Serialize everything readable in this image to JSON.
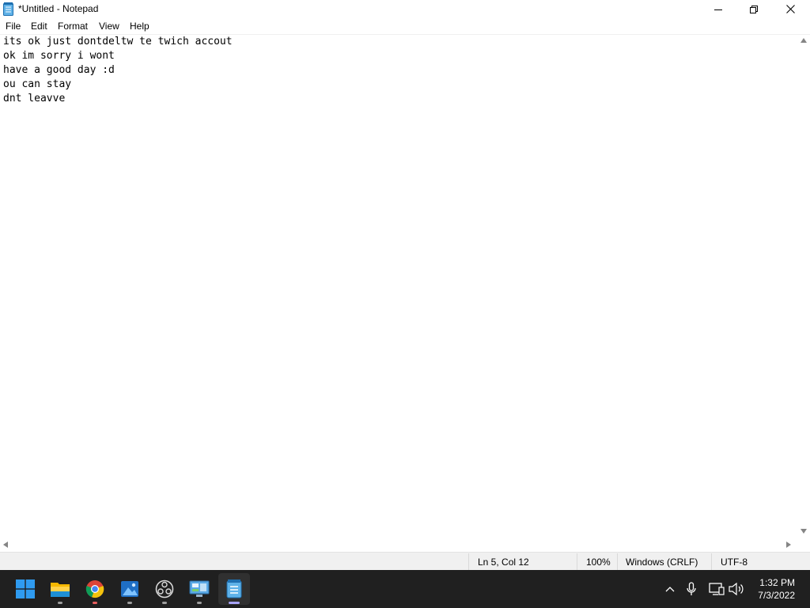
{
  "window": {
    "title": "*Untitled - Notepad",
    "buttons": {
      "minimize": "minimize",
      "maximize": "restore",
      "close": "close"
    }
  },
  "menu": {
    "items": [
      {
        "label": "File"
      },
      {
        "label": "Edit"
      },
      {
        "label": "Format"
      },
      {
        "label": "View"
      },
      {
        "label": "Help"
      }
    ]
  },
  "editor": {
    "lines": [
      "its ok just dontdeltw te twich accout",
      "ok im sorry i wont",
      "have a good day :d",
      "ou can stay",
      "dnt leavve"
    ]
  },
  "status": {
    "position": "Ln 5, Col 12",
    "zoom": "100%",
    "line_ending": "Windows (CRLF)",
    "encoding": "UTF-8"
  },
  "taskbar": {
    "apps": [
      {
        "name": "start",
        "icon": "windows-logo-icon"
      },
      {
        "name": "file-explorer",
        "icon": "folder-icon"
      },
      {
        "name": "chrome",
        "icon": "chrome-icon"
      },
      {
        "name": "photos",
        "icon": "photos-icon"
      },
      {
        "name": "obs",
        "icon": "obs-icon"
      },
      {
        "name": "control-panel",
        "icon": "control-panel-icon"
      },
      {
        "name": "notepad",
        "icon": "notepad-icon",
        "active": true
      }
    ],
    "tray": [
      "chevron-up-icon",
      "microphone-icon",
      "display-icon",
      "volume-icon"
    ],
    "time": "1:32 PM",
    "date": "7/3/2022"
  },
  "colors": {
    "taskbar_bg": "#202020",
    "active_indicator": "#a8a4f8",
    "status_bg": "#f0f0f0"
  }
}
